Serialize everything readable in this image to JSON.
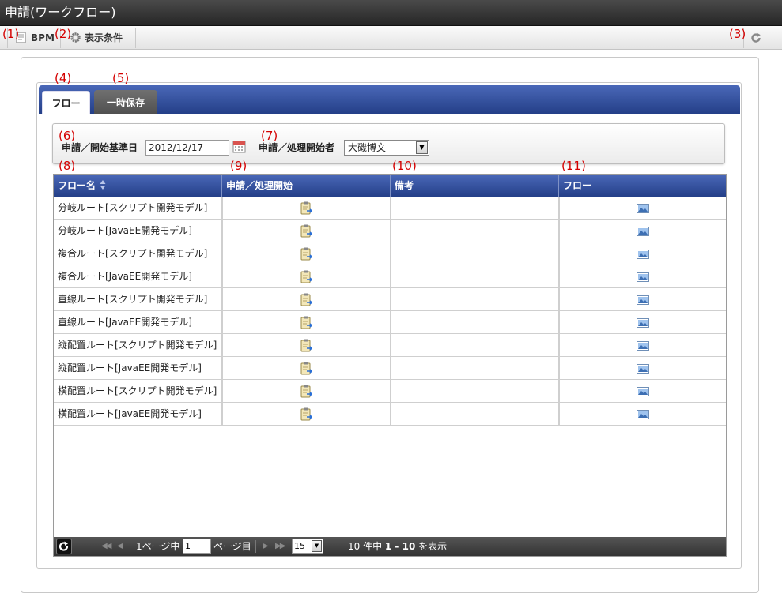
{
  "window": {
    "title": "申請(ワークフロー)"
  },
  "toolbar": {
    "bpm_label": "BPM",
    "conditions_label": "表示条件"
  },
  "callouts": [
    "(1)",
    "(2)",
    "(3)",
    "(4)",
    "(5)",
    "(6)",
    "(7)",
    "(8)",
    "(9)",
    "(10)",
    "(11)"
  ],
  "tabs": [
    {
      "label": "フロー"
    },
    {
      "label": "一時保存"
    }
  ],
  "search": {
    "date_label": "申請／開始基準日",
    "date_value": "2012/12/17",
    "user_label": "申請／処理開始者",
    "user_value": "大磯博文"
  },
  "grid": {
    "columns": [
      "フロー名",
      "申請／処理開始",
      "備考",
      "フロー"
    ],
    "rows": [
      {
        "name": "分岐ルート[スクリプト開発モデル]",
        "note": ""
      },
      {
        "name": "分岐ルート[JavaEE開発モデル]",
        "note": ""
      },
      {
        "name": "複合ルート[スクリプト開発モデル]",
        "note": ""
      },
      {
        "name": "複合ルート[JavaEE開発モデル]",
        "note": ""
      },
      {
        "name": "直線ルート[スクリプト開発モデル]",
        "note": ""
      },
      {
        "name": "直線ルート[JavaEE開発モデル]",
        "note": ""
      },
      {
        "name": "縦配置ルート[スクリプト開発モデル]",
        "note": ""
      },
      {
        "name": "縦配置ルート[JavaEE開発モデル]",
        "note": ""
      },
      {
        "name": "横配置ルート[スクリプト開発モデル]",
        "note": ""
      },
      {
        "name": "横配置ルート[JavaEE開発モデル]",
        "note": ""
      }
    ],
    "row_icons": {
      "start": "clipboard-icon",
      "flow": "image-icon"
    }
  },
  "pager": {
    "prefix": "1ページ中",
    "page": "1",
    "suffix": "ページ目",
    "page_size": "15",
    "summary_a": "10 件中 ",
    "summary_b": "1 - 10",
    "summary_c": " を表示"
  },
  "colors": {
    "header_blue": "#2e4a97",
    "callout_red": "#d40000",
    "titlebar": "#333333"
  }
}
